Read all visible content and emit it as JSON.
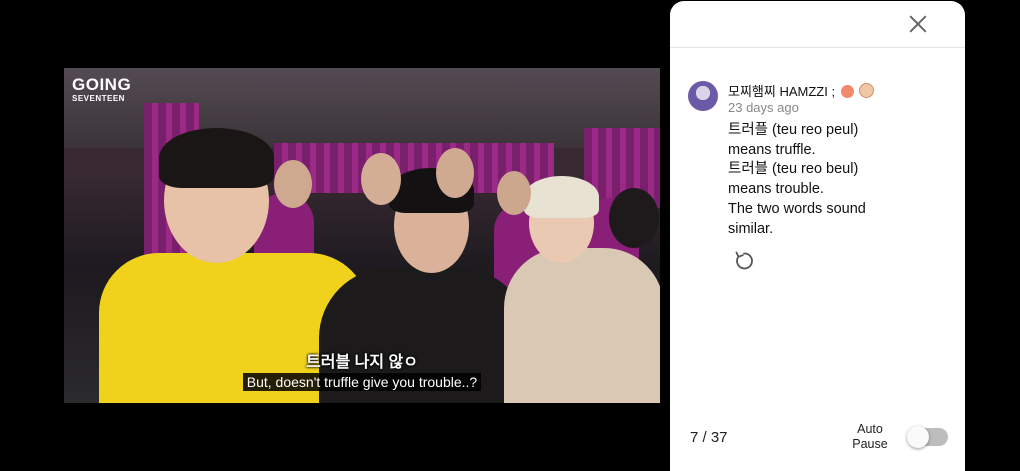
{
  "video": {
    "logo_line1": "GOING",
    "logo_line2": "SEVENTEEN",
    "subtitle_korean": "트러블 나지 않ㅇ",
    "subtitle_english": "But, doesn't truffle give you trouble..?"
  },
  "panel": {
    "close_icon": "close-icon",
    "comment": {
      "author": "모찌햄찌 HAMZZI ;",
      "author_emojis": [
        "peach-emoji",
        "hamster-emoji"
      ],
      "posted": "23 days ago",
      "lines": [
        "트러플 (teu reo peul)",
        "means truffle.",
        "트러블 (teu reo beul)",
        "means trouble.",
        "The two words sound",
        "similar."
      ],
      "replay_icon": "replay-icon"
    },
    "counter": "7 / 37",
    "auto_pause_line1": "Auto",
    "auto_pause_line2": "Pause",
    "auto_pause_enabled": false
  },
  "colors": {
    "panel_bg": "#ffffff",
    "curtain": "#8a2078",
    "toggle_off": "#bdbdbd"
  }
}
